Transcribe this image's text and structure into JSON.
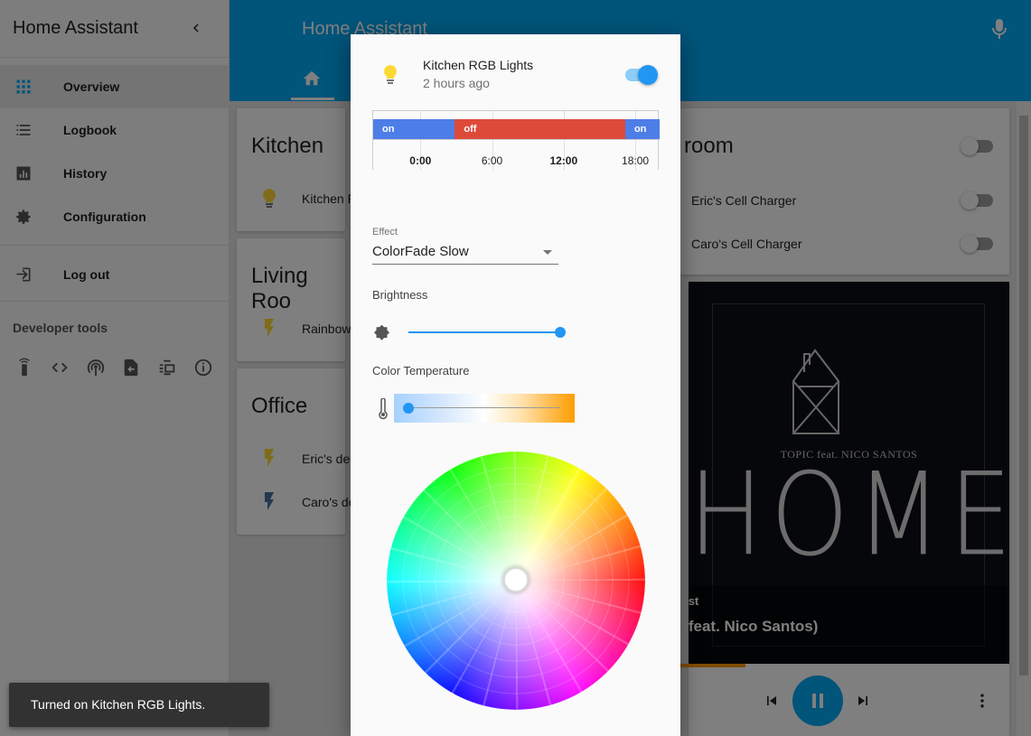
{
  "sidebar": {
    "title": "Home Assistant",
    "items": [
      {
        "label": "Overview",
        "icon": "apps-grid-icon"
      },
      {
        "label": "Logbook",
        "icon": "list-icon"
      },
      {
        "label": "History",
        "icon": "chart-icon"
      },
      {
        "label": "Configuration",
        "icon": "gear-icon"
      },
      {
        "label": "Log out",
        "icon": "logout-icon"
      }
    ],
    "dev_tools_title": "Developer tools",
    "dev_tools_icons": [
      "remote-icon",
      "code-icon",
      "broadcast-icon",
      "file-export-icon",
      "template-icon",
      "info-icon"
    ]
  },
  "header": {
    "title": "Home Assistant"
  },
  "cards": {
    "kitchen": {
      "title": "Kitchen",
      "entities": [
        "Kitchen R"
      ]
    },
    "living_room": {
      "title": "Living Roo",
      "entities": [
        "Rainbow"
      ]
    },
    "office": {
      "title": "Office",
      "entities": [
        "Eric's de",
        "Caro's de"
      ]
    },
    "bedroom": {
      "title": "room",
      "entities": [
        "Eric's Cell Charger",
        "Caro's Cell Charger"
      ]
    }
  },
  "media": {
    "artist_text": "TOPIC feat. NICO SANTOS",
    "art_text": "HOME",
    "app_name": "ecast",
    "track": "e (feat. Nico Santos)"
  },
  "dialog": {
    "entity_name": "Kitchen RGB Lights",
    "last_changed": "2 hours ago",
    "state_on": true,
    "timeline": {
      "segments": [
        {
          "state": "on",
          "color": "#4d7ee8",
          "start": 0.0,
          "end": 0.285
        },
        {
          "state": "off",
          "color": "#dd4a3a",
          "start": 0.285,
          "end": 0.88
        },
        {
          "state": "on",
          "color": "#4d7ee8",
          "start": 0.88,
          "end": 1.0
        }
      ],
      "ticks": [
        {
          "label": "0:00",
          "pos": 0.165,
          "bold": true
        },
        {
          "label": "6:00",
          "pos": 0.415,
          "bold": false
        },
        {
          "label": "12:00",
          "pos": 0.665,
          "bold": true
        },
        {
          "label": "18:00",
          "pos": 0.915,
          "bold": false
        }
      ]
    },
    "effect_label": "Effect",
    "effect_value": "ColorFade Slow",
    "brightness_label": "Brightness",
    "brightness_value": 1.0,
    "color_temp_label": "Color Temperature",
    "color_temp_value": 0.0
  },
  "toast": {
    "message": "Turned on Kitchen RGB Lights."
  },
  "colors": {
    "primary": "#03a9f4",
    "accent": "#2196f3",
    "on": "#4d7ee8",
    "off": "#dd4a3a",
    "bulb_on": "#fdd835"
  }
}
